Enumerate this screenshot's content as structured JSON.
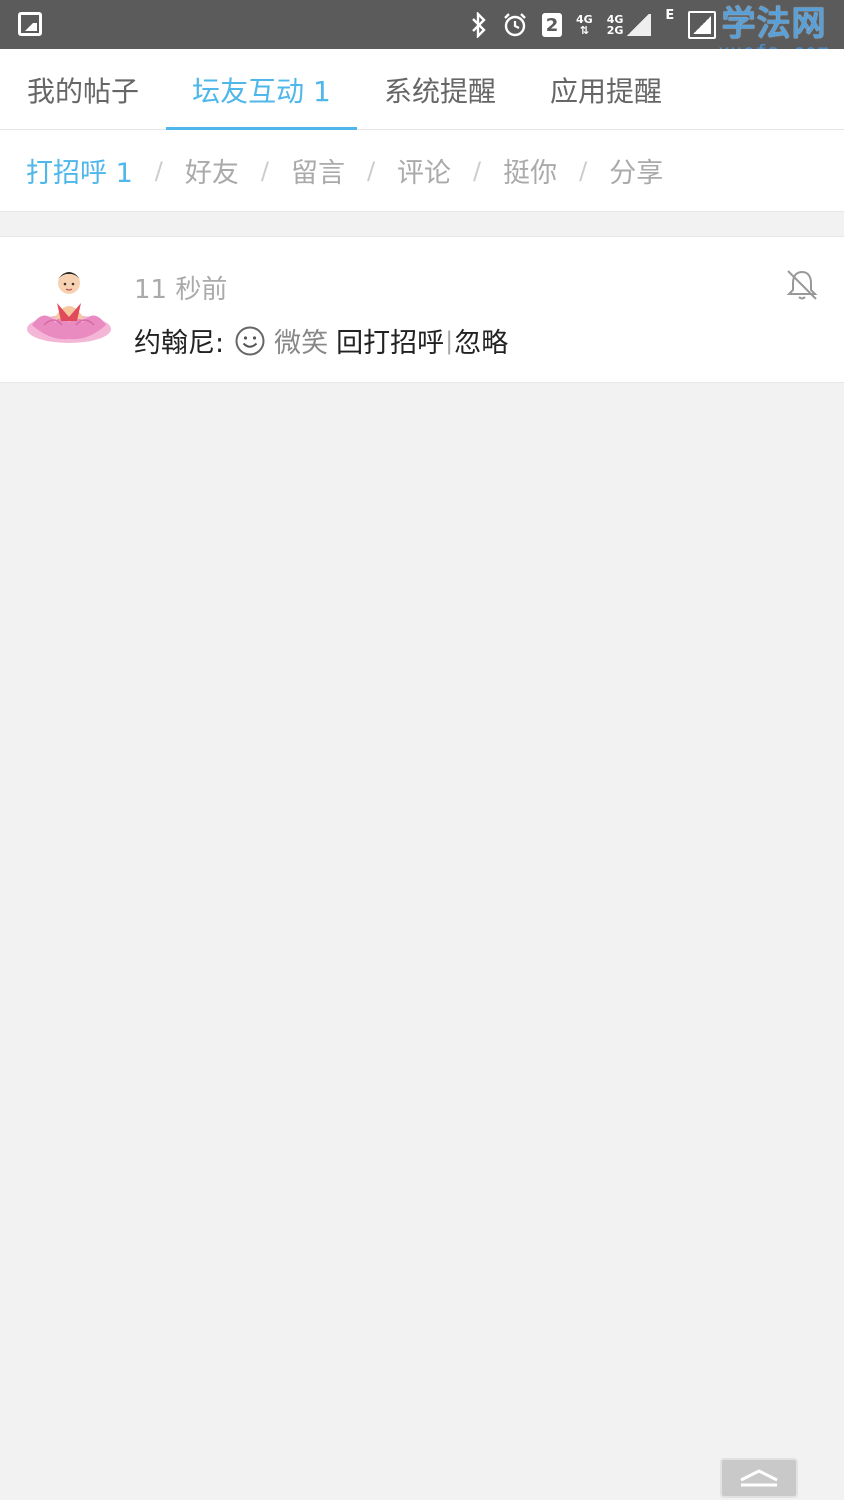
{
  "statusbar": {
    "icons": [
      "image-icon",
      "bluetooth-icon",
      "alarm-icon",
      "sim-2-icon",
      "4g-icon",
      "4g-2g-signal-icon",
      "e-icon",
      "signal-icon"
    ],
    "sim_label": "2",
    "net1_top": "4G",
    "net1_bottom": "⇅",
    "net2_top": "4G",
    "net2_bottom": "2G",
    "net3": "E"
  },
  "watermark": {
    "cn": "学法网",
    "en": "xuefa.com"
  },
  "tabs": [
    {
      "label": "我的帖子",
      "active": false
    },
    {
      "label": "坛友互动 1",
      "active": true
    },
    {
      "label": "系统提醒",
      "active": false
    },
    {
      "label": "应用提醒",
      "active": false
    }
  ],
  "subtabs": [
    {
      "label": "打招呼 1",
      "active": true
    },
    {
      "label": "好友",
      "active": false
    },
    {
      "label": "留言",
      "active": false
    },
    {
      "label": "评论",
      "active": false
    },
    {
      "label": "挺你",
      "active": false
    },
    {
      "label": "分享",
      "active": false
    }
  ],
  "separator": "/",
  "notification": {
    "time_ago": "11 秒前",
    "user": "约翰尼:",
    "emoji": "smile-icon",
    "emoji_text": "微笑",
    "reply_action": "回打招呼",
    "divider": "|",
    "ignore_action": "忽略",
    "bell": "bell-off-icon"
  },
  "colors": {
    "accent": "#4fb7ea",
    "statusbar": "#5b5b5b",
    "background": "#f2f2f2"
  },
  "scroll_top_icon": "chevron-up-icon"
}
